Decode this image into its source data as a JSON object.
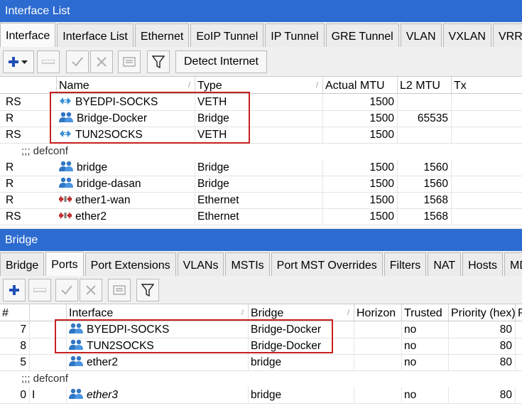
{
  "interface_window": {
    "title": "Interface List",
    "tabs": [
      "Interface",
      "Interface List",
      "Ethernet",
      "EoIP Tunnel",
      "IP Tunnel",
      "GRE Tunnel",
      "VLAN",
      "VXLAN",
      "VRR"
    ],
    "detect_button": "Detect Internet",
    "columns": [
      "Name",
      "Type",
      "Actual MTU",
      "L2 MTU",
      "Tx"
    ],
    "rows": [
      {
        "flags": "RS",
        "name": "BYEDPI-SOCKS",
        "type": "VETH",
        "mtu": "1500",
        "l2mtu": "",
        "icon": "veth-icon"
      },
      {
        "flags": "R",
        "name": "Bridge-Docker",
        "type": "Bridge",
        "mtu": "1500",
        "l2mtu": "65535",
        "icon": "bridge-icon"
      },
      {
        "flags": "RS",
        "name": "TUN2SOCKS",
        "type": "VETH",
        "mtu": "1500",
        "l2mtu": "",
        "icon": "veth-icon"
      },
      {
        "comment": ";;; defconf"
      },
      {
        "flags": "R",
        "name": "bridge",
        "type": "Bridge",
        "mtu": "1500",
        "l2mtu": "1560",
        "icon": "bridge-icon"
      },
      {
        "flags": "R",
        "name": "bridge-dasan",
        "type": "Bridge",
        "mtu": "1500",
        "l2mtu": "1560",
        "icon": "bridge-icon"
      },
      {
        "flags": "R",
        "name": "ether1-wan",
        "type": "Ethernet",
        "mtu": "1500",
        "l2mtu": "1568",
        "icon": "ethernet-icon"
      },
      {
        "flags": "RS",
        "name": "ether2",
        "type": "Ethernet",
        "mtu": "1500",
        "l2mtu": "1568",
        "icon": "ethernet-icon"
      }
    ]
  },
  "bridge_window": {
    "title": "Bridge",
    "tabs": [
      "Bridge",
      "Ports",
      "Port Extensions",
      "VLANs",
      "MSTIs",
      "Port MST Overrides",
      "Filters",
      "NAT",
      "Hosts",
      "MDB"
    ],
    "columns": [
      "#",
      "",
      "Interface",
      "Bridge",
      "Horizon",
      "Trusted",
      "Priority (hex)",
      "P"
    ],
    "rows": [
      {
        "num": "7",
        "flag": "",
        "iface": "BYEDPI-SOCKS",
        "bridge": "Bridge-Docker",
        "trusted": "no",
        "priority": "80"
      },
      {
        "num": "8",
        "flag": "",
        "iface": "TUN2SOCKS",
        "bridge": "Bridge-Docker",
        "trusted": "no",
        "priority": "80"
      },
      {
        "num": "5",
        "flag": "",
        "iface": "ether2",
        "bridge": "bridge",
        "trusted": "no",
        "priority": "80"
      },
      {
        "comment": ";;; defconf"
      },
      {
        "num": "0",
        "flag": "I",
        "iface": "ether3",
        "bridge": "bridge",
        "trusted": "no",
        "priority": "80"
      }
    ]
  },
  "colors": {
    "titlebar": "#2c6bd0",
    "highlight": "#c82020",
    "add_icon": "#1f4fb5"
  }
}
